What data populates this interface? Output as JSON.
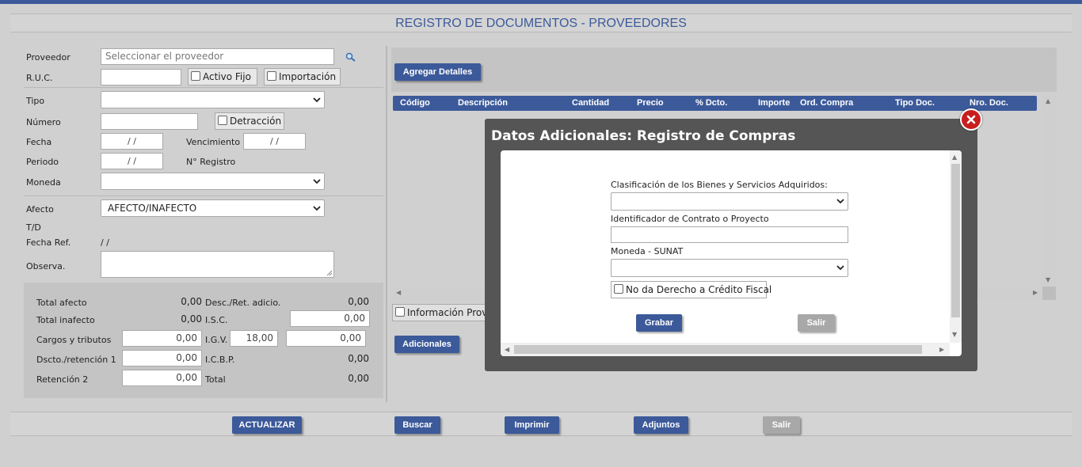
{
  "page_title": "REGISTRO DE DOCUMENTOS - PROVEEDORES",
  "form": {
    "proveedor_label": "Proveedor",
    "proveedor_placeholder": "Seleccionar el proveedor",
    "ruc_label": "R.U.C.",
    "activo_fijo_label": "Activo Fijo",
    "importacion_label": "Importación",
    "tipo_label": "Tipo",
    "numero_label": "Número",
    "detraccion_label": "Detracción",
    "fecha_label": "Fecha",
    "fecha_value": "/ /",
    "vencimiento_label": "Vencimiento",
    "vencimiento_value": "/ /",
    "periodo_label": "Periodo",
    "periodo_value": "/ /",
    "nro_registro_label": "N° Registro",
    "moneda_label": "Moneda",
    "afecto_label": "Afecto",
    "afecto_value": "AFECTO/INAFECTO",
    "td_label": "T/D",
    "fecha_ref_label": "Fecha Ref.",
    "fecha_ref_value": "/ /",
    "observa_label": "Observa."
  },
  "totals": {
    "total_afecto_label": "Total afecto",
    "total_afecto_value": "0,00",
    "desc_ret_label": "Desc./Ret. adicio.",
    "desc_ret_value": "0,00",
    "total_inafecto_label": "Total inafecto",
    "total_inafecto_value": "0,00",
    "isc_label": "I.S.C.",
    "isc_value": "0,00",
    "cargos_label": "Cargos y tributos",
    "cargos_value": "0,00",
    "igv_label": "I.G.V.",
    "igv_rate": "18,00",
    "igv_value": "0,00",
    "dscto_label": "Dscto./retención 1",
    "dscto_value": "0,00",
    "icbp_label": "I.C.B.P.",
    "icbp_value": "0,00",
    "retencion2_label": "Retención 2",
    "retencion2_value": "0,00",
    "total_label": "Total",
    "total_value": "0,00"
  },
  "detail": {
    "agregar_label": "Agregar Detalles",
    "columns": [
      "Código",
      "Descripción",
      "Cantidad",
      "Precio",
      "% Dcto.",
      "Importe",
      "Ord. Compra",
      "Tipo Doc.",
      "Nro. Doc."
    ],
    "info_prov_label": "Información Prov",
    "adicionales_label": "Adicionales"
  },
  "bottom": {
    "actualizar": "ACTUALIZAR",
    "buscar": "Buscar",
    "imprimir": "Imprimir",
    "adjuntos": "Adjuntos",
    "salir": "Salir"
  },
  "modal": {
    "title": "Datos Adicionales: Registro de Compras",
    "clasificacion_label": "Clasificación de los Bienes y Servicios Adquiridos:",
    "identificador_label": "Identificador de Contrato o Proyecto",
    "moneda_label": "Moneda - SUNAT",
    "no_derecho_label": "No da Derecho a Crédito Fiscal",
    "grabar": "Grabar",
    "salir": "Salir"
  },
  "colors": {
    "accent": "#3c5a9a",
    "close": "#c81e1e"
  }
}
